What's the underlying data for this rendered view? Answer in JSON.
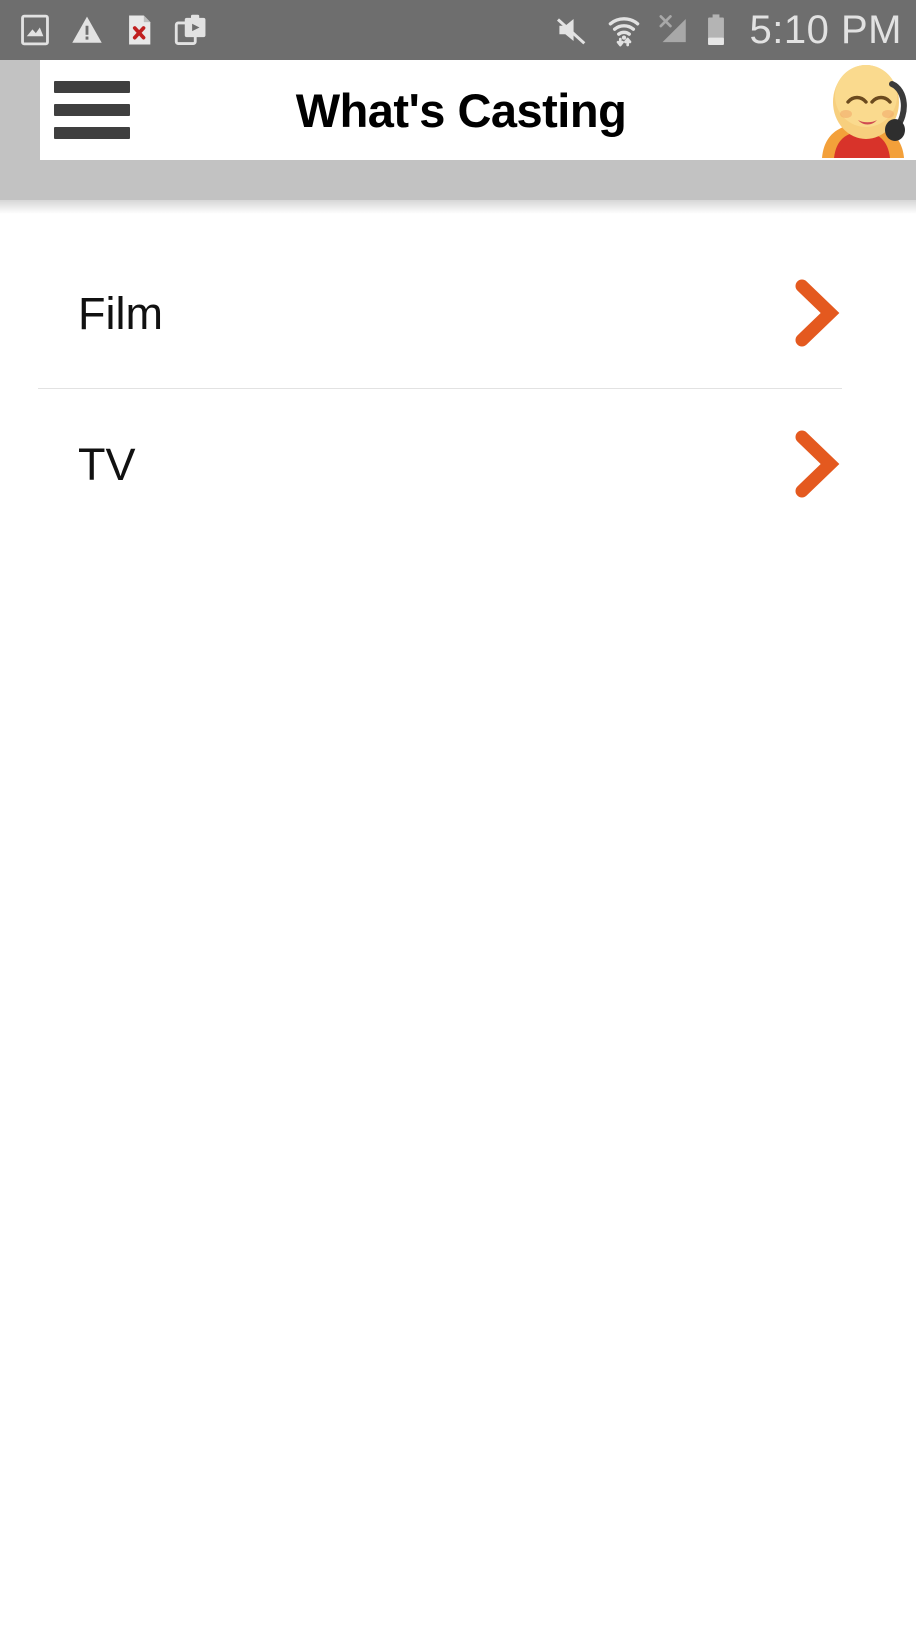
{
  "status_bar": {
    "time": "5:10 PM",
    "background_color": "#6e6e6e",
    "text_color": "#e2e2e2",
    "left_icons": [
      {
        "name": "screenshot-image-icon",
        "label": "Screenshot captured"
      },
      {
        "name": "warning-triangle-icon",
        "label": "Warning"
      },
      {
        "name": "file-error-icon",
        "label": "File error"
      },
      {
        "name": "media-clipboard-icon",
        "label": "Media"
      }
    ],
    "right_icons": [
      {
        "name": "volume-muted-icon",
        "label": "Sound muted"
      },
      {
        "name": "wifi-transfer-icon",
        "label": "Wi-Fi connected"
      },
      {
        "name": "cellular-no-signal-icon",
        "label": "No cellular signal"
      },
      {
        "name": "battery-icon",
        "label": "Battery low"
      }
    ]
  },
  "app_bar": {
    "title": "What's Casting",
    "menu_label": "Menu",
    "avatar_label": "Profile",
    "background_color": "#ffffff",
    "title_color": "#000000"
  },
  "main": {
    "accent_color": "#e4591f",
    "divider_color": "#e2e2e2",
    "categories": [
      {
        "label": "Film",
        "chevron": "chevron-right-icon"
      },
      {
        "label": "TV",
        "chevron": "chevron-right-icon"
      }
    ]
  }
}
